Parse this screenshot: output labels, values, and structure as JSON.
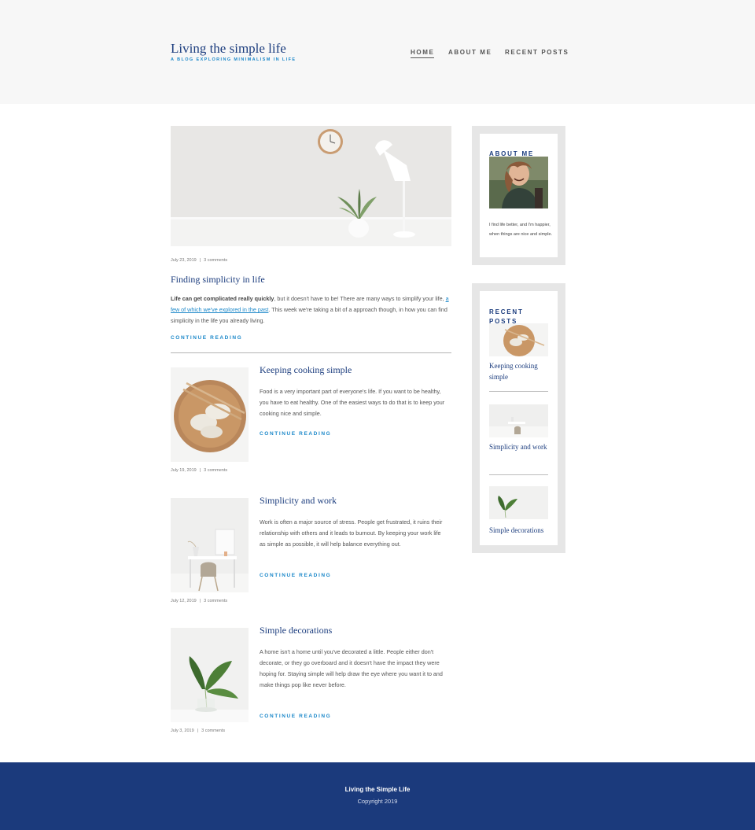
{
  "site": {
    "title": "Living the simple life",
    "tagline": "A BLOG EXPLORING MINIMALISM IN LIFE"
  },
  "nav": {
    "items": [
      {
        "label": "HOME",
        "active": true
      },
      {
        "label": "ABOUT ME",
        "active": false
      },
      {
        "label": "RECENT POSTS",
        "active": false
      }
    ]
  },
  "featured": {
    "image": "desk-with-clock-lamp-plant-image",
    "date": "July 23, 2019",
    "separator": "|",
    "comments": "3 comments",
    "title": "Finding simplicity in life",
    "excerpt_bold": "Life can get complicated really quickly",
    "excerpt_part1": ", but it doesn't have to be! There are many ways to simplify your life, ",
    "excerpt_link": "a few of which we've explored in the past",
    "excerpt_part2": ". This week we're taking a bit of a approach though, in how you can find simplicity in the life you already living.",
    "continue": "CONTINUE READING"
  },
  "posts": [
    {
      "image": "dumplings-plate-image",
      "title": "Keeping cooking simple",
      "excerpt": "Food is a very important part of everyone's life. If you want to be healthy, you have to eat healthy. One of the easiest ways to do that is to keep your cooking nice and simple.",
      "continue": "CONTINUE READING",
      "date": "July 19, 2019",
      "separator": "|",
      "comments": "3 comments"
    },
    {
      "image": "desk-and-chair-image",
      "title": "Simplicity and work",
      "excerpt": "Work is often a major source of stress. People get frustrated, it ruins their relationship with others and it leads to burnout. By keeping your work life as simple as possible, it will help balance everything out.",
      "continue": "CONTINUE READING",
      "date": "July 12, 2019",
      "separator": "|",
      "comments": "3 comments"
    },
    {
      "image": "leaf-in-vase-image",
      "title": "Simple decorations",
      "excerpt": "A home isn't a home until you've decorated a little. People either don't decorate, or they go overboard and it doesn't have the impact they were hoping for. Staying simple will help draw the eye where you want it to and make things pop like never before.",
      "continue": "CONTINUE READING",
      "date": "July 3, 2019",
      "separator": "|",
      "comments": "3 comments"
    }
  ],
  "sidebar": {
    "about": {
      "title": "ABOUT ME",
      "image": "smiling-person-photo",
      "text": "I find life better, and I'm happier, when things are nice and simple."
    },
    "recent": {
      "title": "RECENT POSTS",
      "items": [
        {
          "image": "dumplings-plate-image",
          "title": "Keeping cooking simple"
        },
        {
          "image": "desk-and-chair-image",
          "title": "Simplicity and work"
        },
        {
          "image": "leaf-in-vase-image",
          "title": "Simple decorations"
        }
      ]
    }
  },
  "footer": {
    "title": "Living the Simple Life",
    "copyright": "Copyright 2019"
  },
  "colors": {
    "accent": "#1a87c9",
    "heading": "#1c3d7e",
    "footer_bg": "#1b3a7c",
    "header_bg": "#f7f7f7",
    "widget_bg": "#e6e6e6"
  }
}
